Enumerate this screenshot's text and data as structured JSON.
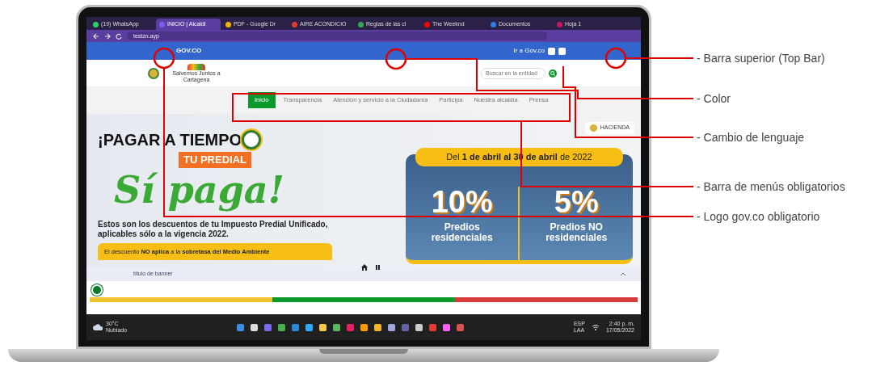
{
  "browser": {
    "tabs": [
      {
        "label": "(19) WhatsApp",
        "selected": false,
        "color": "#25d366"
      },
      {
        "label": "INICIO | Alcaldí",
        "selected": true,
        "color": "#7b5cf0"
      },
      {
        "label": "PDF - Google Dr",
        "selected": false,
        "color": "#f4b400"
      },
      {
        "label": "AIRE ACONDICIO",
        "selected": false,
        "color": "#e53935"
      },
      {
        "label": "Reglas de las cl",
        "selected": false,
        "color": "#34a853"
      },
      {
        "label": "The Weeknd",
        "selected": false,
        "color": "#ff0000"
      },
      {
        "label": "Documentos",
        "selected": false,
        "color": "#2f7de1"
      },
      {
        "label": "Hoja 1",
        "selected": false,
        "color": "#c2185b"
      }
    ],
    "address": "testzn.ayp"
  },
  "gov_bar": {
    "logo": "GOV.CO",
    "link": "Ir a Gov.co"
  },
  "header": {
    "logo_text": "Salvemos Juntos a Cartagena",
    "search": {
      "placeholder": "Buscar en la entidad"
    }
  },
  "nav": [
    {
      "label": "Inicio",
      "selected": true
    },
    {
      "label": "Transparencia",
      "selected": false
    },
    {
      "label": "Atención y servicio a la Ciudadanía",
      "selected": false
    },
    {
      "label": "Participa",
      "selected": false
    },
    {
      "label": "Nuestra alcaldía",
      "selected": false
    },
    {
      "label": "Prensa",
      "selected": false
    }
  ],
  "banner": {
    "headline": "¡PAGAR A TIEMPO",
    "ribbon": "TU PREDIAL",
    "slogan": "Sí paga!",
    "text": "Estos son los descuentos de tu **Impuesto Predial Unificado,** aplicables sólo a la vigencia 2022.",
    "note": "El descuento **NO aplica** a la **sobretasa del Medio Ambiente**",
    "period": "Del **1 de abril al 30 de abril** de 2022",
    "hacienda": "HACIENDA",
    "discounts": [
      {
        "value": "10%",
        "label": "Predios residenciales"
      },
      {
        "value": "5%",
        "label": "Predios NO residenciales"
      }
    ],
    "caption": "título de banner"
  },
  "color_bar": [
    {
      "color": "#f2c42c"
    },
    {
      "color": "#0c9a2c"
    },
    {
      "color": "#d63a3a"
    }
  ],
  "taskbar": {
    "temperature": "30°C",
    "weather": "Nublado",
    "lang": "ESP",
    "layout": "LAA",
    "time": "2:40 p. m.",
    "date": "17/05/2022",
    "apps": [
      {
        "color": "#3a8ee6"
      },
      {
        "color": "#dddddd"
      },
      {
        "color": "#7a6cf0"
      },
      {
        "color": "#4caf50"
      },
      {
        "color": "#2b88d8"
      },
      {
        "color": "#31a8ff"
      },
      {
        "color": "#f7c948"
      },
      {
        "color": "#5cb85c"
      },
      {
        "color": "#e91e63"
      },
      {
        "color": "#ff9a00"
      },
      {
        "color": "#f2b71e"
      },
      {
        "color": "#9fa8da"
      },
      {
        "color": "#6264a7"
      },
      {
        "color": "#cccccc"
      },
      {
        "color": "#e53935"
      },
      {
        "color": "#ff61f6"
      },
      {
        "color": "#d9534f"
      }
    ]
  },
  "annotations": [
    {
      "label": "- Barra superior (Top Bar)"
    },
    {
      "label": "- Color"
    },
    {
      "label": "- Cambio de lenguaje"
    },
    {
      "label": "- Barra de menús obligatorios"
    },
    {
      "label": "- Logo gov.co obligatorio"
    }
  ]
}
